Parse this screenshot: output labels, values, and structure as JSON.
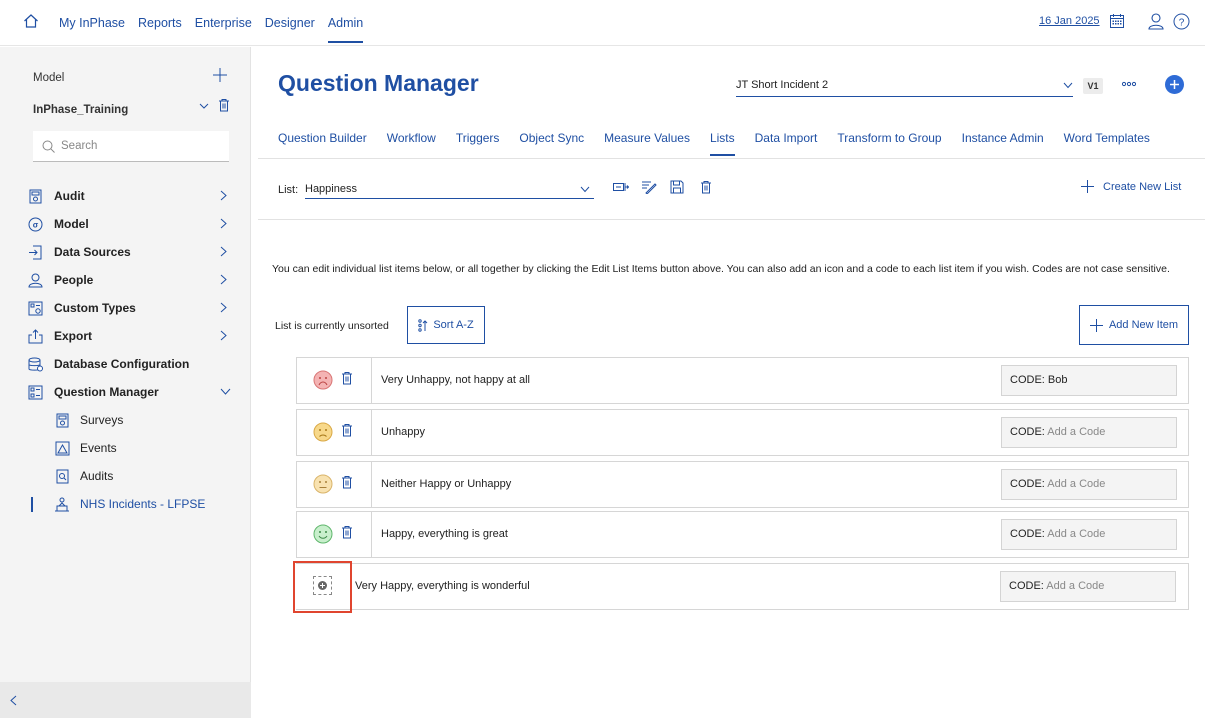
{
  "topnav": {
    "items": [
      "My InPhase",
      "Reports",
      "Enterprise",
      "Designer",
      "Admin"
    ],
    "active": "Admin",
    "date": "16 Jan 2025"
  },
  "sidebar": {
    "model_label": "Model",
    "model_name": "InPhase_Training",
    "search_placeholder": "Search",
    "items": [
      {
        "label": "Audit",
        "icon": "audit-icon"
      },
      {
        "label": "Model",
        "icon": "model-icon"
      },
      {
        "label": "Data Sources",
        "icon": "data-sources-icon"
      },
      {
        "label": "People",
        "icon": "people-icon"
      },
      {
        "label": "Custom Types",
        "icon": "custom-types-icon"
      },
      {
        "label": "Export",
        "icon": "export-icon"
      },
      {
        "label": "Database Configuration",
        "icon": "database-icon"
      },
      {
        "label": "Question Manager",
        "icon": "question-manager-icon"
      }
    ],
    "subitems": [
      {
        "label": "Surveys",
        "icon": "surveys-icon"
      },
      {
        "label": "Events",
        "icon": "events-icon"
      },
      {
        "label": "Audits",
        "icon": "audits-icon"
      },
      {
        "label": "NHS Incidents - LFPSE",
        "icon": "nhs-incidents-icon"
      }
    ]
  },
  "header": {
    "title": "Question Manager",
    "model_select": "JT Short Incident 2",
    "version": "V1"
  },
  "tabs": [
    "Question Builder",
    "Workflow",
    "Triggers",
    "Object Sync",
    "Measure Values",
    "Lists",
    "Data Import",
    "Transform to Group",
    "Instance Admin",
    "Word Templates"
  ],
  "active_tab": "Lists",
  "listbar": {
    "label": "List:",
    "value": "Happiness",
    "create_label": "Create New List"
  },
  "info_text": "You can edit individual list items below, or all together by clicking the Edit List Items button above. You can also add an icon and a code to each list item if you wish. Codes are not case sensitive.",
  "sort": {
    "status": "List is currently unsorted",
    "button": "Sort A-Z"
  },
  "add_item_label": "Add New Item",
  "code_label": "CODE:",
  "rows": [
    {
      "label": "Very Unhappy, not happy at all",
      "code": "Bob",
      "placeholder": "",
      "face": "very-unhappy-face-icon",
      "color": "#e89090"
    },
    {
      "label": "Unhappy",
      "code": "",
      "placeholder": "Add a Code",
      "face": "unhappy-face-icon",
      "color": "#f2c86a"
    },
    {
      "label": "Neither Happy or Unhappy",
      "code": "",
      "placeholder": "Add a Code",
      "face": "neutral-face-icon",
      "color": "#f2d79a"
    },
    {
      "label": "Happy, everything is great",
      "code": "",
      "placeholder": "Add a Code",
      "face": "happy-face-icon",
      "color": "#8fd69a"
    },
    {
      "label": "Very Happy, everything is wonderful",
      "code": "",
      "placeholder": "Add a Code",
      "face": "add-icon",
      "color": "#666666"
    }
  ]
}
